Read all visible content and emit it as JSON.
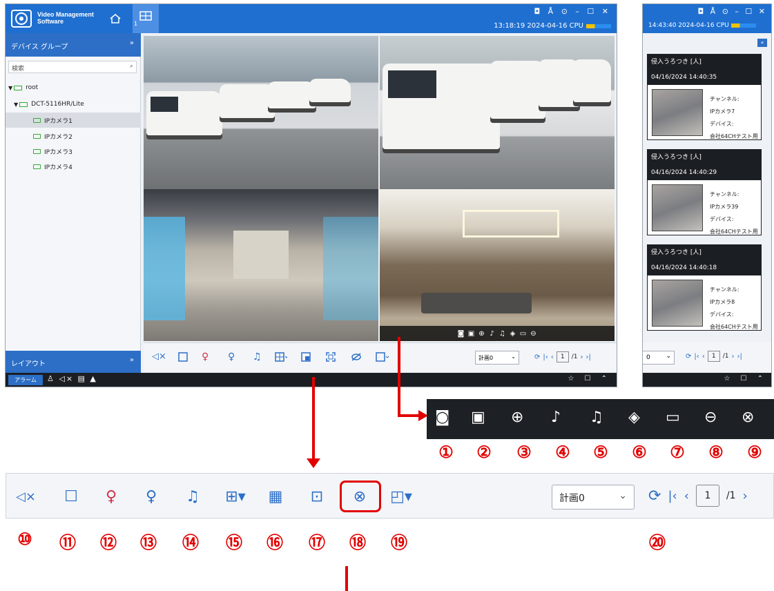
{
  "main_window": {
    "app_name_line1": "Video Management",
    "app_name_line2": "Software",
    "tab_number": "1",
    "window_controls": "◘ Å ⊙ – ☐ ✕",
    "clock": "13:18:19 2024-04-16 CPU",
    "sidebar": {
      "header": "デバイス グループ",
      "search_placeholder": "検索",
      "tree": [
        {
          "label": "root",
          "level": 0
        },
        {
          "label": "DCT-5116HR/Lite",
          "level": 1
        },
        {
          "label": "IPカメラ1",
          "level": 2,
          "selected": true
        },
        {
          "label": "IPカメラ2",
          "level": 2
        },
        {
          "label": "IPカメラ3",
          "level": 2
        },
        {
          "label": "IPカメラ4",
          "level": 2
        }
      ],
      "footer": "レイアウト"
    },
    "toolbar": {
      "plan_select": "計画0",
      "page_current": "1",
      "page_total": "/1"
    },
    "statusbar": {
      "alarm_button": "アラーム"
    }
  },
  "right_window": {
    "clock": "14:43:40 2024-04-16 CPU",
    "alerts": [
      {
        "title": "侵入うろつき [人]",
        "time": "04/16/2024 14:40:35",
        "channel_label": "チャンネル:",
        "channel": "IPカメラ7",
        "device_label": "デバイス:",
        "device": "会社64CHテスト用"
      },
      {
        "title": "侵入うろつき [人]",
        "time": "04/16/2024 14:40:29",
        "channel_label": "チャンネル:",
        "channel": "IPカメラ39",
        "device_label": "デバイス:",
        "device": "会社64CHテスト用"
      },
      {
        "title": "侵入うろつき [人]",
        "time": "04/16/2024 14:40:18",
        "channel_label": "チャンネル:",
        "channel": "IPカメラ8",
        "device_label": "デバイス:",
        "device": "会社64CHテスト用"
      }
    ],
    "select_value": "0",
    "page_current": "1",
    "page_total": "/1"
  },
  "callouts": {
    "camera_toolbar_numbers": [
      "①",
      "②",
      "③",
      "④",
      "⑤",
      "⑥",
      "⑦",
      "⑧",
      "⑨"
    ],
    "main_toolbar_numbers": [
      "⑩",
      "⑪",
      "⑫",
      "⑬",
      "⑭",
      "⑮",
      "⑯",
      "⑰",
      "⑱",
      "⑲",
      "⑳"
    ],
    "big_plan_select": "計画0",
    "big_page_current": "1",
    "big_page_total": "/1"
  },
  "colors": {
    "accent": "#1f6fd0",
    "callout_red": "#e20000"
  }
}
